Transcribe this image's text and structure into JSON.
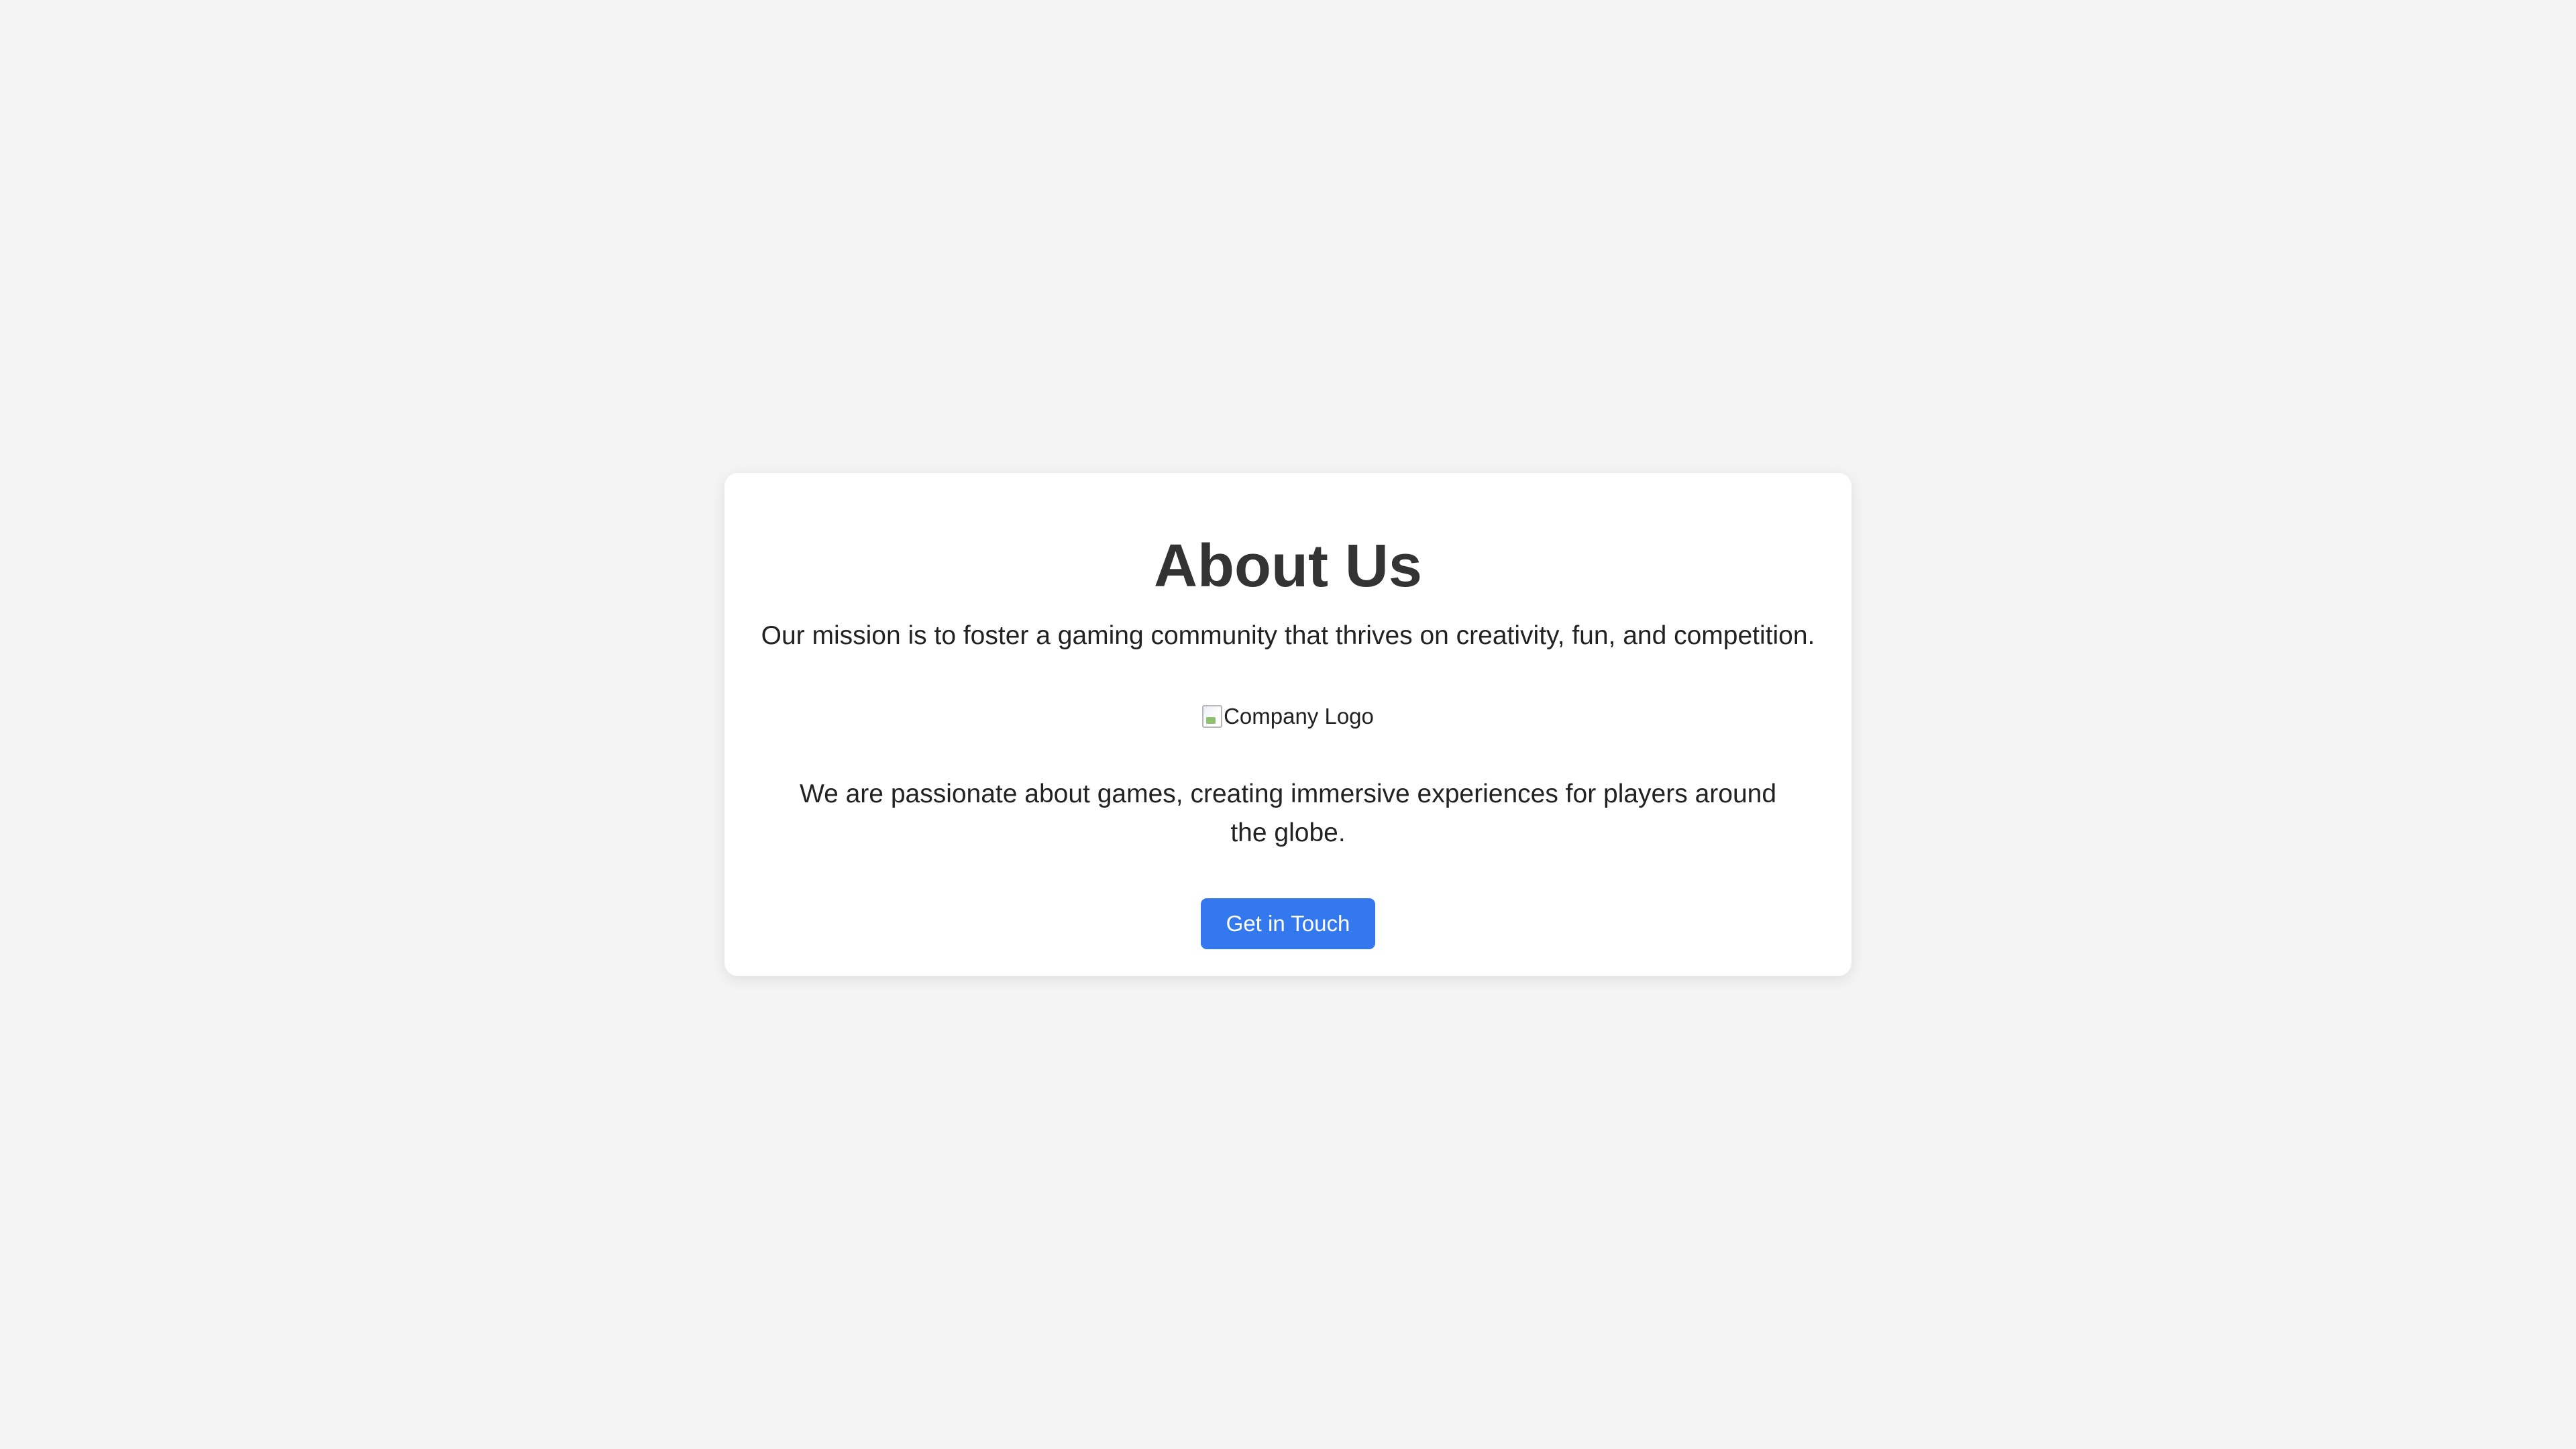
{
  "about": {
    "title": "About Us",
    "mission": "Our mission is to foster a gaming community that thrives on creativity, fun, and competition.",
    "logo_alt": "Company Logo",
    "description": "We are passionate about games, creating immersive experiences for players around the globe.",
    "cta_label": "Get in Touch"
  },
  "colors": {
    "background": "#f4f4f4",
    "card": "#ffffff",
    "accent": "#3478f0",
    "heading": "#333333"
  },
  "icons": {
    "logo": "broken-image-icon"
  }
}
